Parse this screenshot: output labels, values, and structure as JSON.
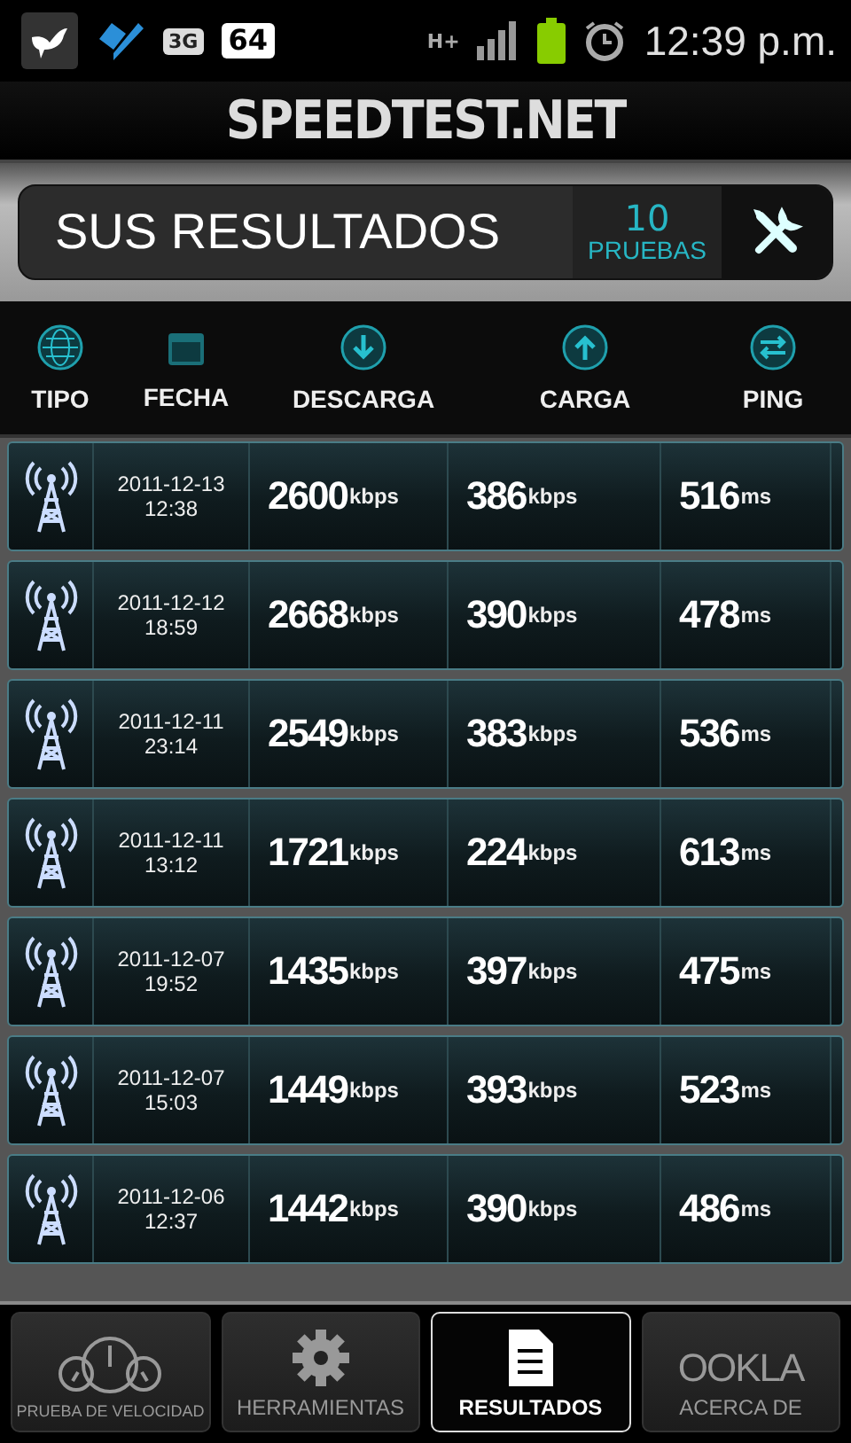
{
  "status_bar": {
    "badge_3g": "3G",
    "notification_count": "64",
    "network_type": "H+",
    "time": "12:39 p.m."
  },
  "header": {
    "title": "SPEEDTEST.NET"
  },
  "results_card": {
    "title": "SUS RESULTADOS",
    "count": "10",
    "count_label": "PRUEBAS"
  },
  "columns": [
    {
      "kind": "type",
      "label": "TIPO"
    },
    {
      "kind": "date",
      "label": "FECHA"
    },
    {
      "kind": "download",
      "label": "DESCARGA"
    },
    {
      "kind": "upload",
      "label": "CARGA"
    },
    {
      "kind": "ping",
      "label": "PING"
    }
  ],
  "rows": [
    {
      "date": "2011-12-13",
      "time": "12:38",
      "download": "2600",
      "download_unit": "kbps",
      "upload": "386",
      "upload_unit": "kbps",
      "ping": "516",
      "ping_unit": "ms"
    },
    {
      "date": "2011-12-12",
      "time": "18:59",
      "download": "2668",
      "download_unit": "kbps",
      "upload": "390",
      "upload_unit": "kbps",
      "ping": "478",
      "ping_unit": "ms"
    },
    {
      "date": "2011-12-11",
      "time": "23:14",
      "download": "2549",
      "download_unit": "kbps",
      "upload": "383",
      "upload_unit": "kbps",
      "ping": "536",
      "ping_unit": "ms"
    },
    {
      "date": "2011-12-11",
      "time": "13:12",
      "download": "1721",
      "download_unit": "kbps",
      "upload": "224",
      "upload_unit": "kbps",
      "ping": "613",
      "ping_unit": "ms"
    },
    {
      "date": "2011-12-07",
      "time": "19:52",
      "download": "1435",
      "download_unit": "kbps",
      "upload": "397",
      "upload_unit": "kbps",
      "ping": "475",
      "ping_unit": "ms"
    },
    {
      "date": "2011-12-07",
      "time": "15:03",
      "download": "1449",
      "download_unit": "kbps",
      "upload": "393",
      "upload_unit": "kbps",
      "ping": "523",
      "ping_unit": "ms"
    },
    {
      "date": "2011-12-06",
      "time": "12:37",
      "download": "1442",
      "download_unit": "kbps",
      "upload": "390",
      "upload_unit": "kbps",
      "ping": "486",
      "ping_unit": "ms"
    }
  ],
  "nav": [
    {
      "kind": "speed",
      "label": "PRUEBA DE VELOCIDAD",
      "selected": false
    },
    {
      "kind": "tools",
      "label": "HERRAMIENTAS",
      "selected": false
    },
    {
      "kind": "results",
      "label": "RESULTADOS",
      "selected": true
    },
    {
      "kind": "about",
      "logo": "OOKLA",
      "label": "ACERCA DE",
      "selected": false
    }
  ]
}
